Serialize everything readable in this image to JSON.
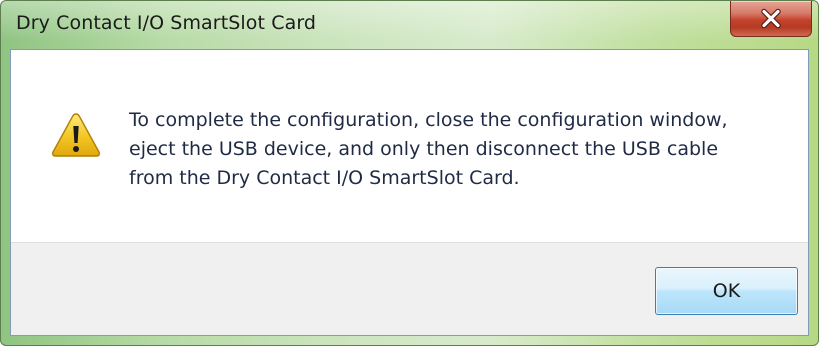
{
  "window": {
    "title": "Dry Contact I/O SmartSlot Card",
    "close_icon": "close-x-icon"
  },
  "dialog": {
    "icon": "warning-triangle-icon",
    "message": "To complete the configuration, close the configuration window,\neject the USB device, and only then disconnect the USB cable\nfrom the Dry Contact I/O SmartSlot Card."
  },
  "buttons": {
    "ok_label": "OK"
  },
  "colors": {
    "warning_yellow": "#f3c623",
    "close_red": "#c2432c",
    "button_blue_border": "#3c7fb1"
  }
}
